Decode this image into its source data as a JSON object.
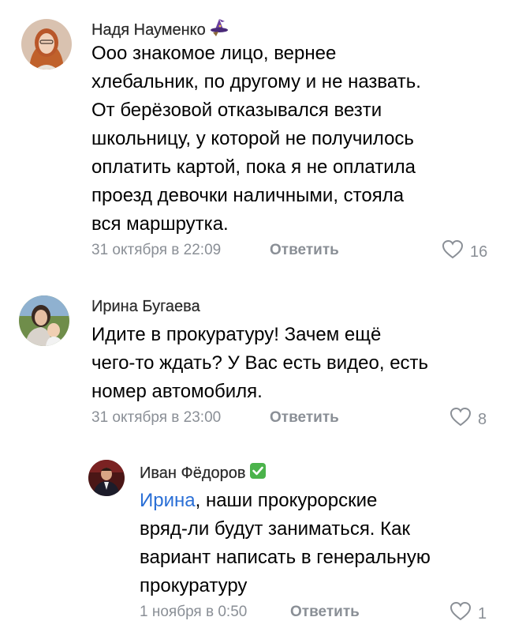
{
  "comments": [
    {
      "author": "Надя Науменко",
      "badge_icon": "witch-hat-icon",
      "lines": [
        "Ооо знакомое лицо, вернее",
        "хлебальник, по другому и не назвать.",
        "От берёзовой отказывался везти",
        "школьницу, у которой не получилось",
        "оплатить картой, пока я не оплатила",
        "проезд девочки наличными, стояла",
        "вся маршрутка."
      ],
      "date": "31 октября в 22:09",
      "reply_label": "Ответить",
      "likes": "16"
    },
    {
      "author": "Ирина Бугаева",
      "lines": [
        "Идите в прокуратуру! Зачем ещё",
        "чего-то ждать? У Вас есть видео, есть",
        "номер автомобиля."
      ],
      "date": "31 октября в 23:00",
      "reply_label": "Ответить",
      "likes": "8"
    },
    {
      "author": "Иван Фёдоров",
      "badge_icon": "check-mark-icon",
      "mention": "Ирина",
      "first_line_rest": ", наши прокурорские",
      "lines": [
        "вряд-ли будут заниматься.  Как",
        "вариант написать в генеральную",
        "прокуратуру"
      ],
      "date": "1 ноября в 0:50",
      "reply_label": "Ответить",
      "likes": "1"
    }
  ],
  "colors": {
    "meta": "#8a8f96",
    "mention": "#2a6fd6",
    "check_badge": "#4bb34b"
  }
}
